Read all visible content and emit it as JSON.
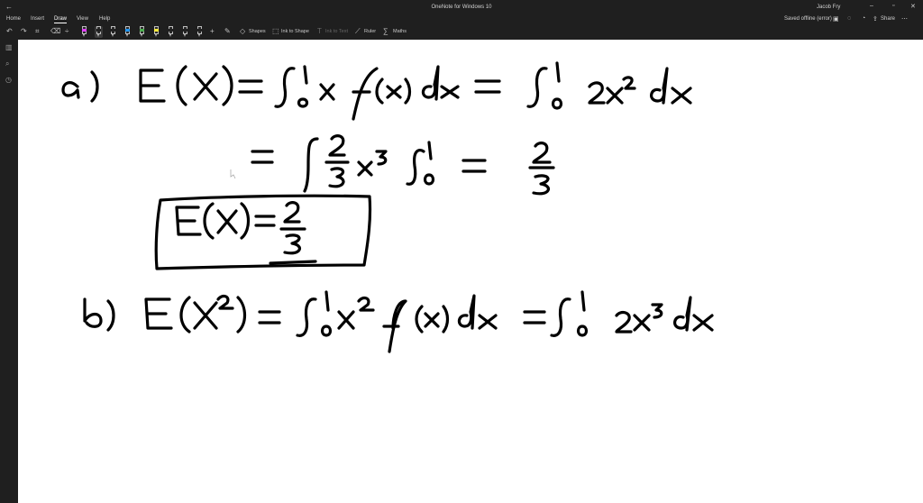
{
  "window": {
    "title": "OneNote for Windows 10",
    "user": "Jacob Fry",
    "controls": {
      "minimize": "–",
      "restore": "▫",
      "close": "✕"
    }
  },
  "menu": {
    "tabs": [
      "Home",
      "Insert",
      "Draw",
      "View",
      "Help"
    ],
    "active_tab": "Draw",
    "status": "Saved offline (error)",
    "share_label": "Share"
  },
  "toolbar": {
    "shapes_label": "Shapes",
    "ink_to_shape_label": "Ink to Shape",
    "ink_to_text_label": "Ink to Text",
    "ruler_label": "Ruler",
    "maths_label": "Maths",
    "pen_colors": [
      "#e040fb",
      "#212121",
      "#212121",
      "#2196f3",
      "#4caf50",
      "#ffeb3b",
      "#212121",
      "#212121",
      "#212121",
      "#212121",
      "#212121"
    ]
  },
  "sidebar": {
    "icons": [
      "notebooks-icon",
      "search-icon",
      "recent-icon"
    ]
  },
  "notes": {
    "ink_color": "#000000",
    "line_a": {
      "label": "a)",
      "lhs": "E(X) = ∫₀¹ x f(x) dx = ∫₀¹ 2x² dx",
      "step": "= [ (2/3) x³ ]₀¹ = 2/3",
      "boxed_result": "E(X) = 2/3"
    },
    "line_b": {
      "label": "b)",
      "lhs": "E(X²) = ∫₀¹ x² f(x) dx = ∫₀¹ 2x³ dx"
    }
  }
}
